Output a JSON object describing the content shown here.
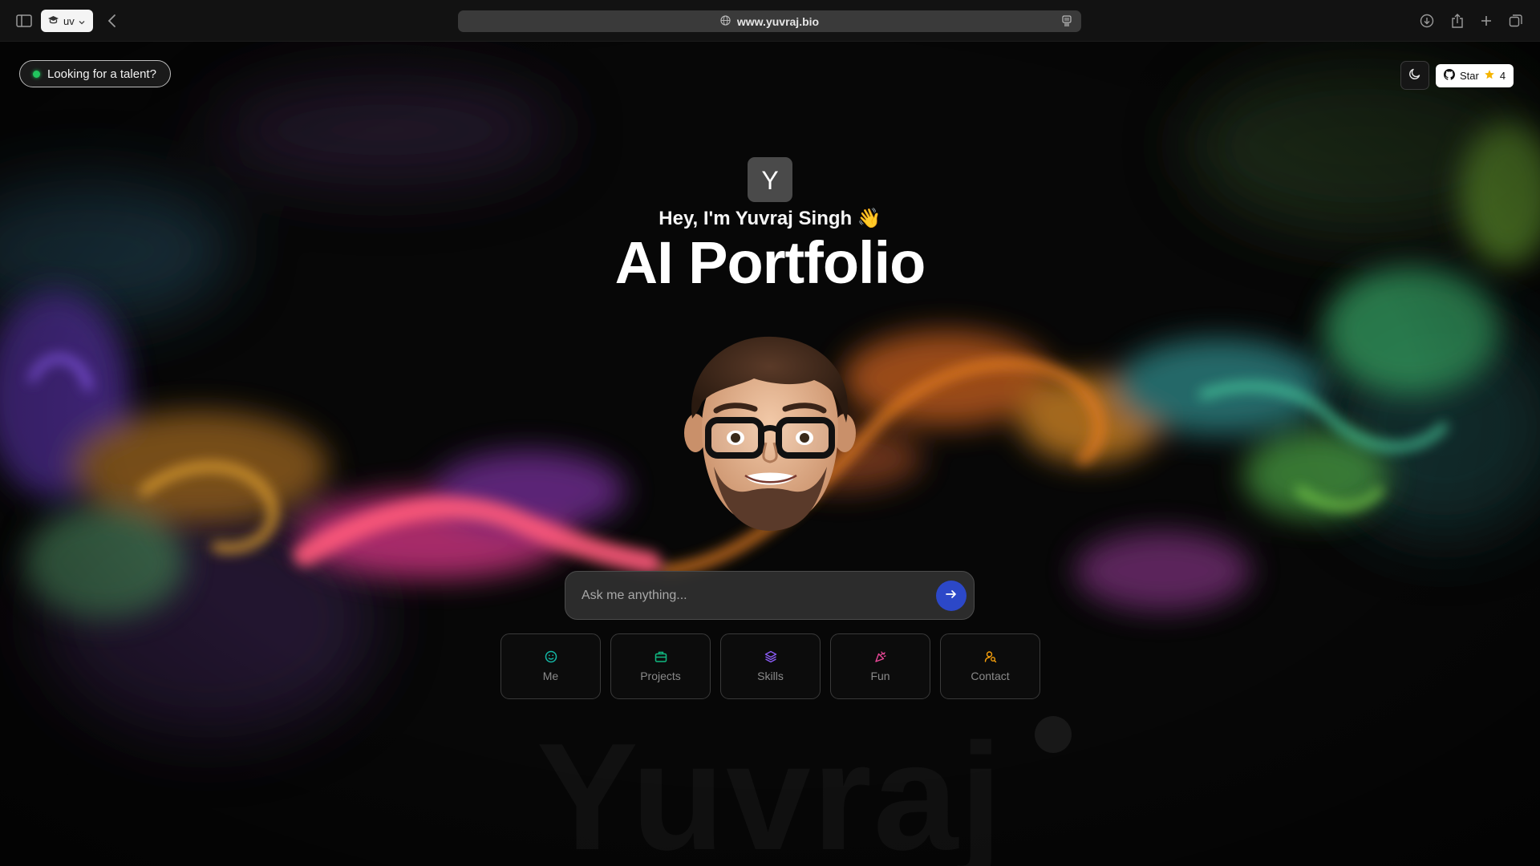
{
  "browser": {
    "tab_label": "uv",
    "url": "www.yuvraj.bio"
  },
  "header": {
    "talent_label": "Looking for a talent?",
    "github_star_label": "Star",
    "github_star_count": "4"
  },
  "hero": {
    "logo_letter": "Y",
    "greeting": "Hey, I'm Yuvraj Singh 👋",
    "title": "AI Portfolio"
  },
  "search": {
    "placeholder": "Ask me anything..."
  },
  "quick_links": [
    {
      "label": "Me",
      "icon": "smile-icon",
      "color": "#14b8a6"
    },
    {
      "label": "Projects",
      "icon": "briefcase-icon",
      "color": "#10b981"
    },
    {
      "label": "Skills",
      "icon": "layers-icon",
      "color": "#8b5cf6"
    },
    {
      "label": "Fun",
      "icon": "party-popper-icon",
      "color": "#ec4899"
    },
    {
      "label": "Contact",
      "icon": "user-search-icon",
      "color": "#f59e0b"
    }
  ],
  "watermark": "Yuvraj",
  "colors": {
    "accent_send": "#2c48c8",
    "status_dot": "#22c55e"
  }
}
